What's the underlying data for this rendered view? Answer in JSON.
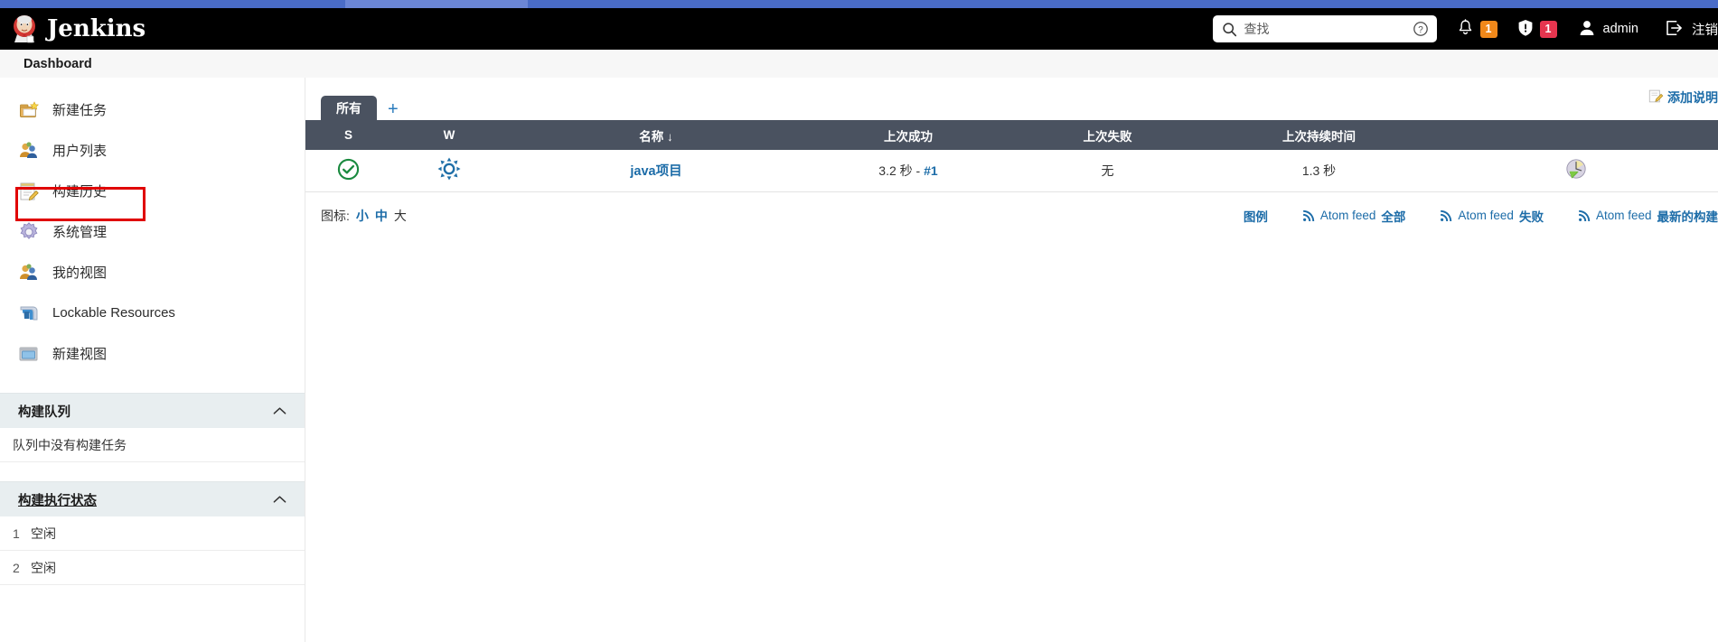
{
  "header": {
    "brand": "Jenkins",
    "logo_icon": "jenkins-butler-icon",
    "search": {
      "icon": "search-icon",
      "placeholder": "查找",
      "value": "",
      "help_icon": "help-circle-icon"
    },
    "notifications": {
      "icon": "bell-icon",
      "count": "1",
      "color": "#f0881a"
    },
    "security": {
      "icon": "shield-alert-icon",
      "count": "1",
      "color": "#e6354f"
    },
    "user": {
      "icon": "person-icon",
      "name": "admin"
    },
    "logout": {
      "icon": "logout-icon",
      "label": "注销"
    }
  },
  "breadcrumb": {
    "items": [
      "Dashboard"
    ]
  },
  "sidebar": {
    "nav": [
      {
        "label": "新建任务",
        "icon": "new-job-icon",
        "highlighted": true
      },
      {
        "label": "用户列表",
        "icon": "people-icon",
        "highlighted": false
      },
      {
        "label": "构建历史",
        "icon": "build-history-icon",
        "highlighted": false
      },
      {
        "label": "系统管理",
        "icon": "gear-icon",
        "highlighted": false
      },
      {
        "label": "我的视图",
        "icon": "people-icon",
        "highlighted": false
      },
      {
        "label": "Lockable Resources",
        "icon": "lock-resource-icon",
        "highlighted": false
      },
      {
        "label": "新建视图",
        "icon": "new-view-icon",
        "highlighted": false
      }
    ],
    "build_queue": {
      "title": "构建队列",
      "collapse_icon": "chevron-up-icon",
      "empty_text": "队列中没有构建任务"
    },
    "build_executor": {
      "title": "构建执行状态",
      "collapse_icon": "chevron-up-icon",
      "executors": [
        {
          "num": "1",
          "status": "空闲"
        },
        {
          "num": "2",
          "status": "空闲"
        }
      ]
    }
  },
  "main": {
    "add_description": {
      "label": "添加说明",
      "icon": "edit-icon"
    },
    "tabs": [
      {
        "label": "所有",
        "active": true
      },
      {
        "label": "+",
        "active": false,
        "name": "add-view-tab"
      }
    ],
    "table": {
      "columns": [
        {
          "key": "s",
          "label": "S"
        },
        {
          "key": "w",
          "label": "W"
        },
        {
          "key": "name",
          "label": "名称",
          "sort": "↓"
        },
        {
          "key": "last_success",
          "label": "上次成功"
        },
        {
          "key": "last_failure",
          "label": "上次失败"
        },
        {
          "key": "last_duration",
          "label": "上次持续时间"
        },
        {
          "key": "actions",
          "label": ""
        }
      ],
      "rows": [
        {
          "status_icon": "success-check-icon",
          "weather_icon": "sunny-icon",
          "name": "java项目",
          "last_success_time": "3.2 秒",
          "last_success_sep": "-",
          "last_success_build": "#1",
          "last_failure": "无",
          "last_duration": "1.3 秒",
          "action_icon": "schedule-build-icon"
        }
      ]
    },
    "footer": {
      "icon_size_label": "图标:",
      "icon_sizes": [
        {
          "label": "小",
          "active": false
        },
        {
          "label": "中",
          "active": false
        },
        {
          "label": "大",
          "active": true
        }
      ],
      "legend_label": "图例",
      "feeds": [
        {
          "prefix": "Atom feed",
          "suffix": "全部",
          "icon": "rss-icon"
        },
        {
          "prefix": "Atom feed",
          "suffix": "失败",
          "icon": "rss-icon"
        },
        {
          "prefix": "Atom feed",
          "suffix": "最新的构建",
          "icon": "rss-icon"
        }
      ]
    }
  },
  "colors": {
    "header_bg": "#000000",
    "table_header_bg": "#4a5260",
    "link_blue": "#1c6ca8",
    "success_green": "#1a8a3f",
    "highlight_red": "#e00000",
    "panel_bg": "#e8eef0"
  }
}
